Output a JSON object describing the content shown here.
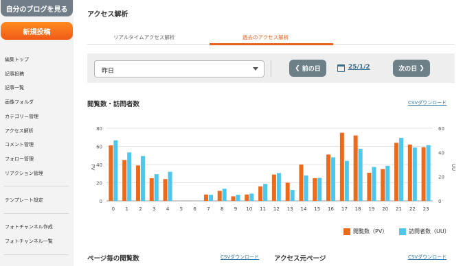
{
  "sidebar": {
    "blog_button": "自分のブログを見る",
    "new_post_button": "新規投稿",
    "items": [
      "編集トップ",
      "記事投稿",
      "記事一覧",
      "画像フォルダ",
      "カテゴリー管理",
      "アクセス解析",
      "コメント管理",
      "フォロー管理",
      "リアクション管理"
    ],
    "items2": [
      "テンプレート設定"
    ],
    "items3": [
      "フォトチャンネル作成",
      "フォトチャンネル一覧"
    ]
  },
  "page_title": "アクセス解析",
  "tabs": {
    "realtime": "リアルタイムアクセス解析",
    "past": "過去のアクセス解析"
  },
  "filter": {
    "period": "昨日",
    "prev_label": "前の日",
    "date": "25/1/2",
    "next_label": "次の日"
  },
  "section1": {
    "title": "閲覧数・訪問者数",
    "csv": "CSVダウンロード"
  },
  "section2": {
    "title": "ページ毎の閲覧数",
    "csv": "CSVダウンロード"
  },
  "section3": {
    "title": "アクセス元ページ",
    "csv": "CSVダウンロード"
  },
  "colors": {
    "pv": "#ec6a1c",
    "uu": "#4ec7ec",
    "accent": "#e8621f",
    "nav_button": "#6e8087"
  },
  "chart_data": {
    "type": "bar",
    "categories": [
      "0",
      "1",
      "2",
      "3",
      "4",
      "5",
      "6",
      "7",
      "8",
      "9",
      "10",
      "11",
      "12",
      "13",
      "14",
      "15",
      "16",
      "17",
      "18",
      "19",
      "20",
      "21",
      "22",
      "23"
    ],
    "series": [
      {
        "name": "閲覧数（PV）",
        "axis": "left",
        "values": [
          61,
          45,
          39,
          25,
          24,
          0,
          0,
          7,
          11,
          5,
          7,
          16,
          29,
          20,
          40,
          25,
          51,
          75,
          72,
          31,
          35,
          64,
          62,
          59
        ]
      },
      {
        "name": "訪問者数（UU）",
        "axis": "right",
        "values": [
          50,
          40,
          37,
          22,
          24,
          0,
          0,
          5,
          10,
          5,
          6,
          14,
          23,
          9,
          21,
          19,
          36,
          33,
          43,
          28,
          29,
          52,
          44,
          46
        ]
      }
    ],
    "ylabel_left": "PV",
    "ylabel_right": "UU",
    "ylim_left": [
      0,
      80
    ],
    "ylim_right": [
      0,
      60
    ],
    "yticks_left": [
      "0",
      "20",
      "40",
      "60",
      "80"
    ],
    "yticks_right": [
      "0",
      "20",
      "40",
      "60"
    ],
    "grid": true,
    "legend": "bottom-right"
  }
}
